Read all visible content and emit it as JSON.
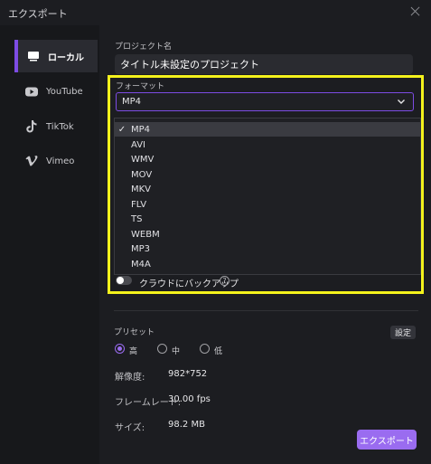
{
  "window": {
    "title": "エクスポート"
  },
  "sidebar": {
    "items": [
      {
        "label": "ローカル",
        "icon": "monitor-icon",
        "active": true
      },
      {
        "label": "YouTube",
        "icon": "youtube-icon",
        "active": false
      },
      {
        "label": "TikTok",
        "icon": "tiktok-icon",
        "active": false
      },
      {
        "label": "Vimeo",
        "icon": "vimeo-icon",
        "active": false
      }
    ]
  },
  "project": {
    "label": "プロジェクト名",
    "value": "タイトル未設定のプロジェクト"
  },
  "format": {
    "label": "フォーマット",
    "selected": "MP4",
    "options": [
      "MP4",
      "AVI",
      "WMV",
      "MOV",
      "MKV",
      "FLV",
      "TS",
      "WEBM",
      "MP3",
      "M4A"
    ]
  },
  "cloud_backup": {
    "label": "クラウドにバックアップ",
    "enabled": false
  },
  "preset": {
    "label": "プリセット",
    "settings_label": "設定",
    "options": [
      {
        "label": "高",
        "checked": true
      },
      {
        "label": "中",
        "checked": false
      },
      {
        "label": "低",
        "checked": false
      }
    ]
  },
  "info": {
    "resolution_label": "解像度:",
    "resolution_value": "982*752",
    "framerate_label": "フレームレート:",
    "framerate_value": "30.00 fps",
    "size_label": "サイズ:",
    "size_value": "98.2 MB"
  },
  "export_button": "エクスポート",
  "colors": {
    "accent": "#9a6cf0",
    "highlight": "#f4f21c",
    "background": "#1c1d21"
  }
}
